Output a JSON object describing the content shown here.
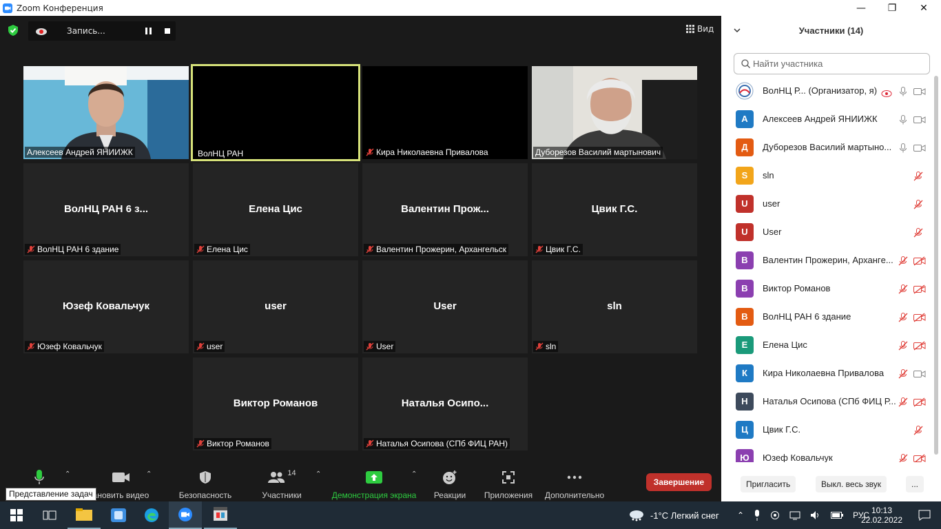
{
  "window": {
    "title": "Zoom Конференция",
    "minimize": "—",
    "restore": "❐",
    "close": "✕"
  },
  "recording": {
    "label": "Запись..."
  },
  "view": {
    "label": "Вид"
  },
  "tiles": [
    {
      "name": "Алексеев Андрей ЯНИИЖК",
      "big": "",
      "muted": false,
      "type": "video1"
    },
    {
      "name": "ВолНЦ РАН",
      "big": "",
      "muted": false,
      "type": "black-active"
    },
    {
      "name": "Кира Николаевна Привалова",
      "big": "",
      "muted": true,
      "type": "black"
    },
    {
      "name": "Дуборезов Василий мартынович",
      "big": "",
      "muted": false,
      "type": "video2"
    },
    {
      "name": "ВолНЦ РАН 6 здание",
      "big": "ВолНЦ РАН 6 з...",
      "muted": true
    },
    {
      "name": "Елена Цис",
      "big": "Елена Цис",
      "muted": true
    },
    {
      "name": "Валентин Прожерин, Архангельск",
      "big": "Валентин  Прож...",
      "muted": true
    },
    {
      "name": "Цвик Г.С.",
      "big": "Цвик Г.С.",
      "muted": true
    },
    {
      "name": "Юзеф Ковальчук",
      "big": "Юзеф Ковальчук",
      "muted": true
    },
    {
      "name": "user",
      "big": "user",
      "muted": true
    },
    {
      "name": "User",
      "big": "User",
      "muted": true
    },
    {
      "name": "sln",
      "big": "sln",
      "muted": true
    },
    {
      "name": "Виктор Романов",
      "big": "Виктор Романов",
      "muted": true
    },
    {
      "name": "Наталья Осипова (СПб ФИЦ РАН)",
      "big": "Наталья  Осипо...",
      "muted": true
    }
  ],
  "toolbar": {
    "mute_label": "",
    "video_label": "ановить видео",
    "security_label": "Безопасность",
    "participants_label": "Участники",
    "participants_count": "14",
    "share_label": "Демонстрация экрана",
    "reactions_label": "Реакции",
    "apps_label": "Приложения",
    "more_label": "Дополнительно",
    "end_label": "Завершение",
    "tooltip": "Представление задач"
  },
  "panel": {
    "title": "Участники (14)",
    "search_placeholder": "Найти участника",
    "participants": [
      {
        "initial": "",
        "color": "#ffffff",
        "name": "ВолНЦ Р...  (Организатор, я)",
        "mic": "on",
        "cam": "on",
        "host": true
      },
      {
        "initial": "А",
        "color": "#1f7ac4",
        "name": "Алексеев Андрей ЯНИИЖК",
        "mic": "on",
        "cam": "on"
      },
      {
        "initial": "Д",
        "color": "#e35b12",
        "name": "Дуборезов Василий мартыно...",
        "mic": "on",
        "cam": "on"
      },
      {
        "initial": "S",
        "color": "#f2a51a",
        "name": "sln",
        "mic": "off",
        "cam": "none"
      },
      {
        "initial": "U",
        "color": "#c0312b",
        "name": "user",
        "mic": "off",
        "cam": "none"
      },
      {
        "initial": "U",
        "color": "#c0312b",
        "name": "User",
        "mic": "off",
        "cam": "none"
      },
      {
        "initial": "В",
        "color": "#8b3fb0",
        "name": "Валентин Прожерин, Архангe...",
        "mic": "off",
        "cam": "off"
      },
      {
        "initial": "В",
        "color": "#8b3fb0",
        "name": "Виктор Романов",
        "mic": "off",
        "cam": "off"
      },
      {
        "initial": "В",
        "color": "#e35b12",
        "name": "ВолНЦ РАН 6 здание",
        "mic": "off",
        "cam": "off"
      },
      {
        "initial": "Е",
        "color": "#1a9a7a",
        "name": "Елена Цис",
        "mic": "off",
        "cam": "off"
      },
      {
        "initial": "К",
        "color": "#1f7ac4",
        "name": "Кира Николаевна Привалова",
        "mic": "off",
        "cam": "on"
      },
      {
        "initial": "Н",
        "color": "#3d4a5c",
        "name": "Наталья Осипова (СПб ФИЦ Р...",
        "mic": "off",
        "cam": "off"
      },
      {
        "initial": "Ц",
        "color": "#1f7ac4",
        "name": "Цвик Г.С.",
        "mic": "off",
        "cam": "none"
      },
      {
        "initial": "Ю",
        "color": "#8b3fb0",
        "name": "Юзеф Ковальчук",
        "mic": "off",
        "cam": "off"
      }
    ],
    "invite_label": "Пригласить",
    "mute_all_label": "Выкл. весь звук",
    "more_label": "..."
  },
  "taskbar": {
    "weather": "-1°C  Легкий снег",
    "lang": "РУС",
    "time": "10:13",
    "date": "22.02.2022"
  }
}
